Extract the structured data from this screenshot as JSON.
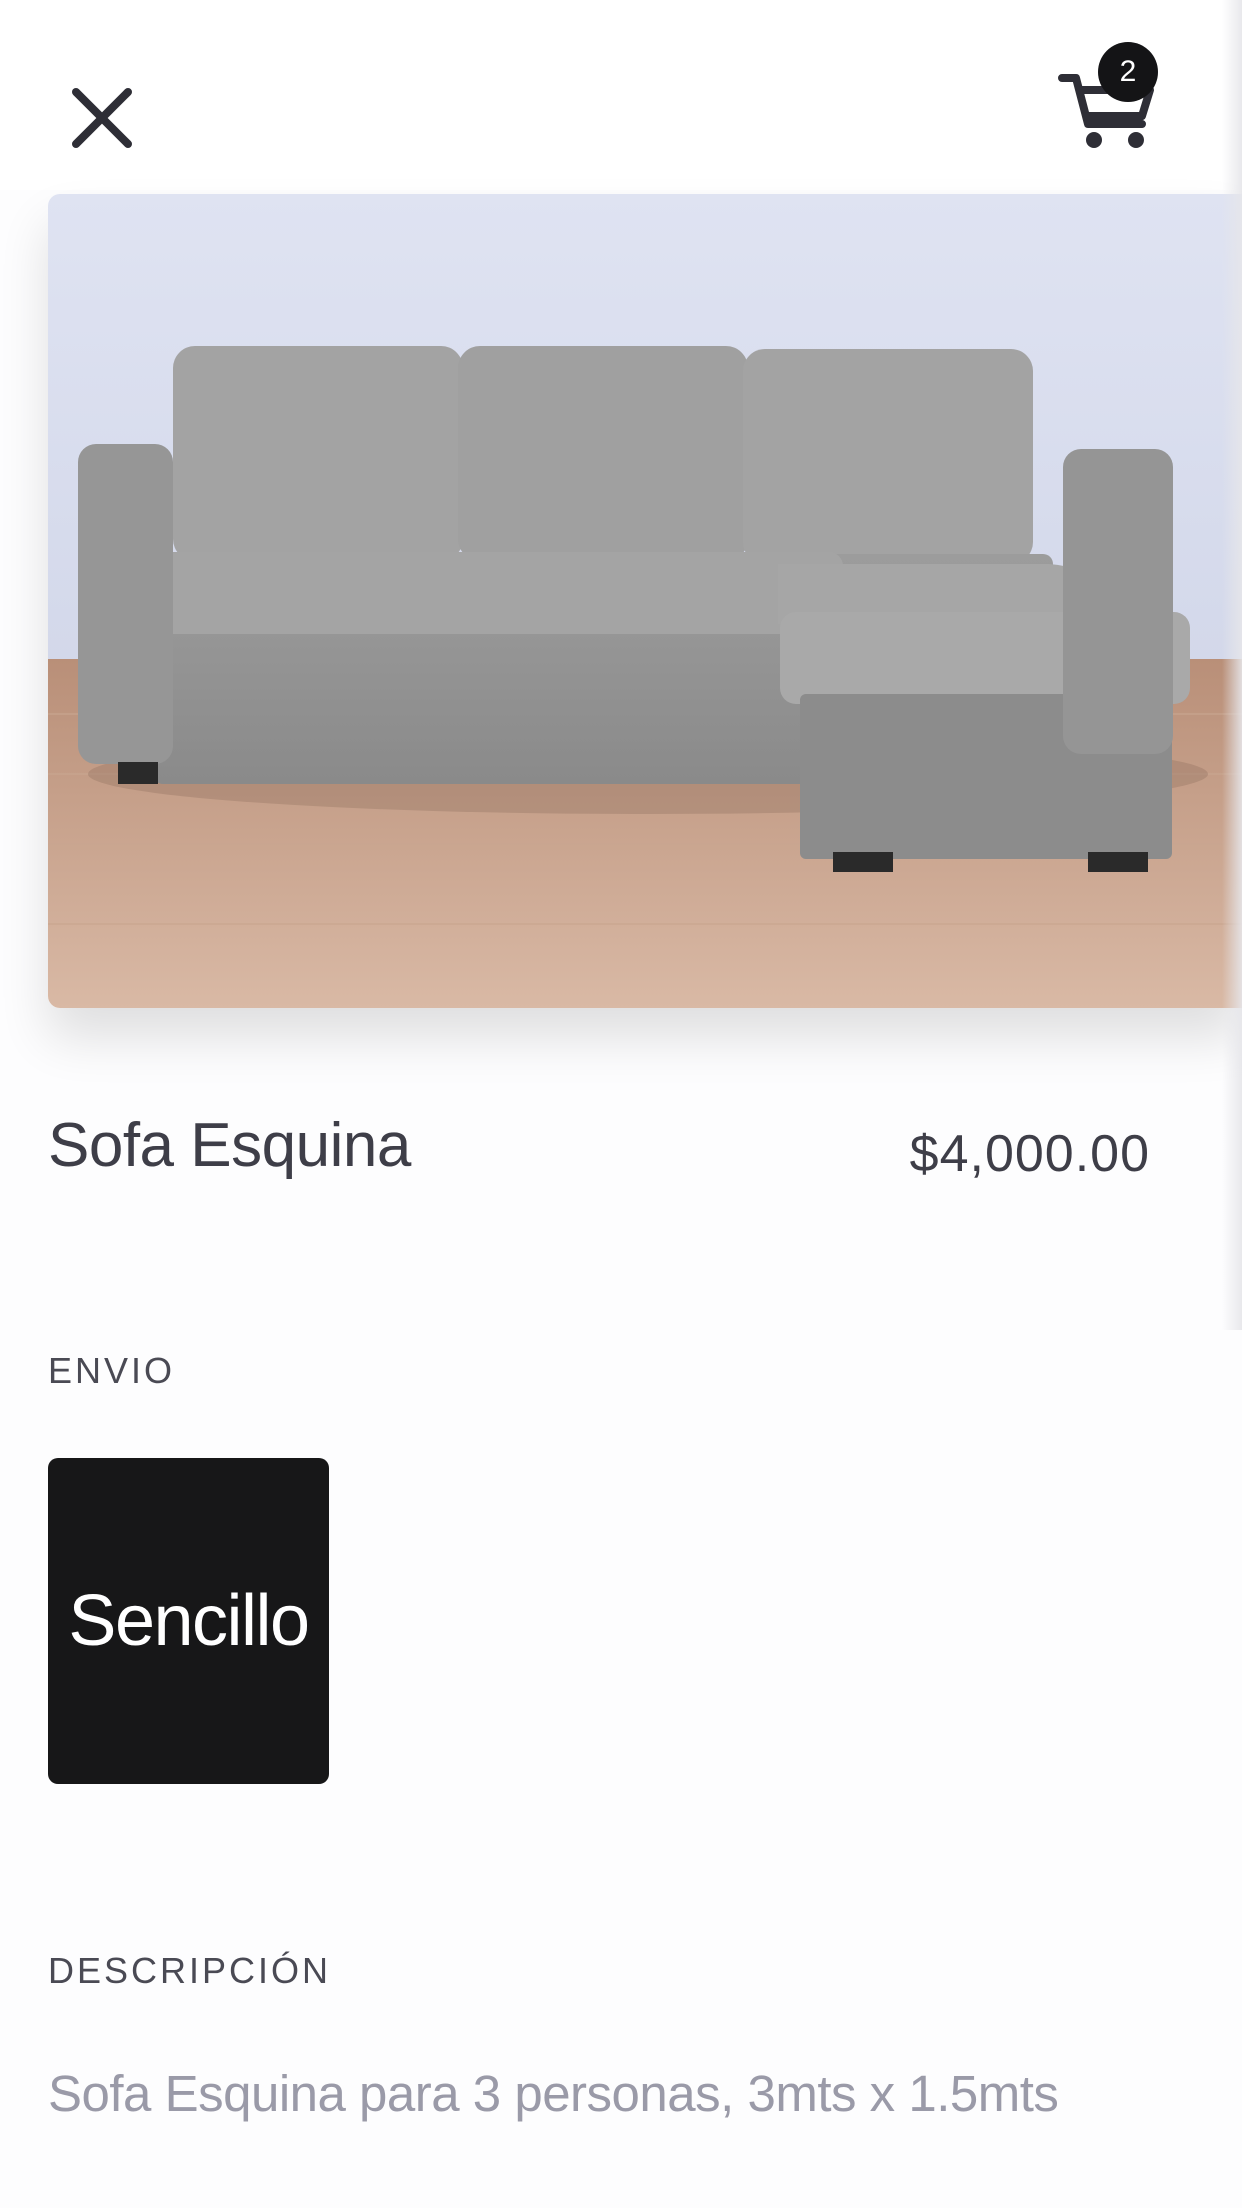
{
  "header": {
    "close_icon": "close-icon",
    "cart_icon": "cart-icon",
    "cart_count": "2"
  },
  "product": {
    "image_subject": "sofa-image",
    "title": "Sofa Esquina",
    "price": "$4,000.00"
  },
  "shipping": {
    "label": "ENVIO",
    "options": [
      {
        "label": "Sencillo",
        "selected": true
      }
    ]
  },
  "description": {
    "label": "DESCRIPCIÓN",
    "text": "Sofa Esquina para 3 personas, 3mts x 1.5mts"
  },
  "colors": {
    "text_primary": "#3e3e48",
    "text_muted": "#9a9aa8",
    "chip_background": "#171718",
    "badge_background": "#141416",
    "page_background": "#fdfdfe"
  }
}
